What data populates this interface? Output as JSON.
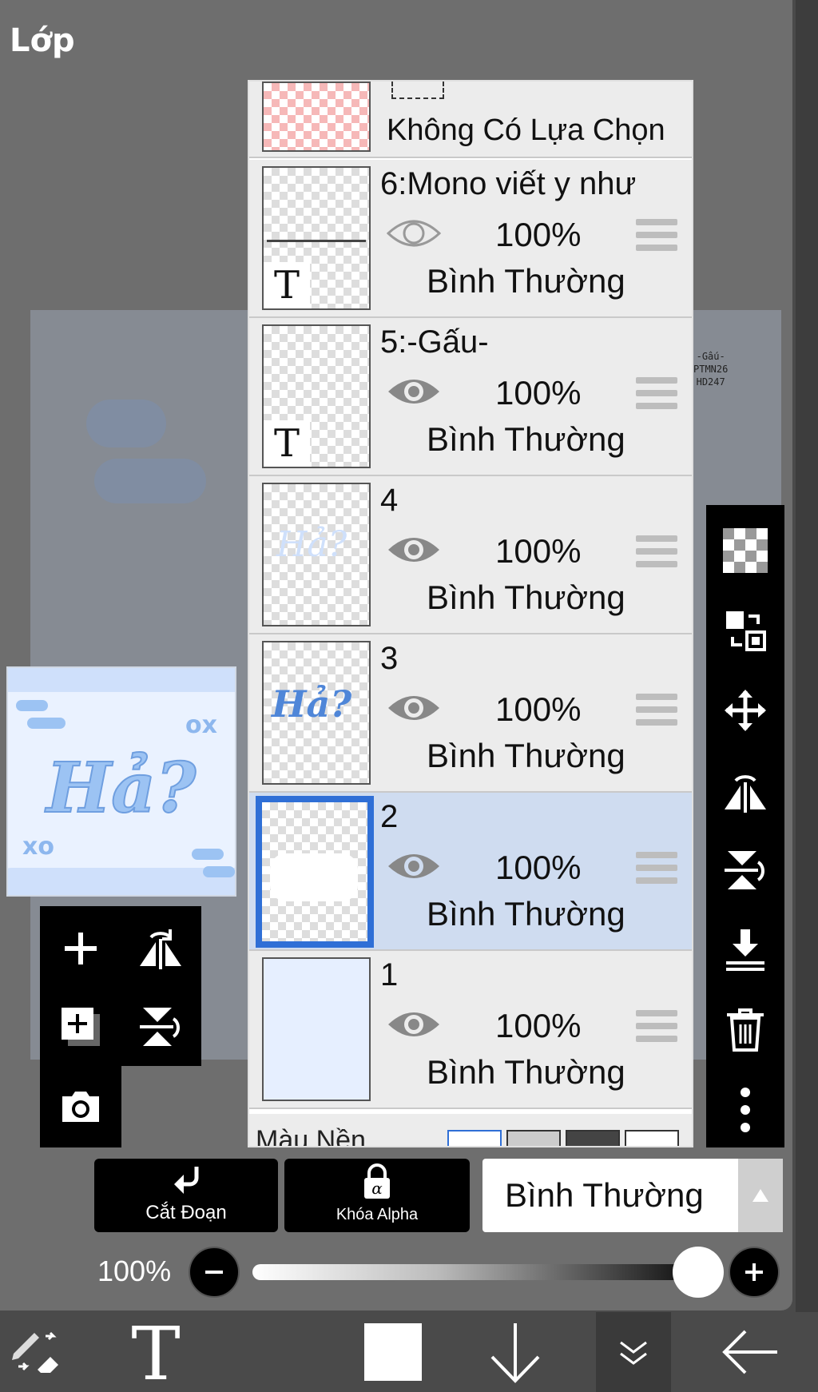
{
  "header": {
    "title": "Lớp"
  },
  "canvas": {
    "watermark_lines": [
      "-Gấu-",
      "PTMN26",
      "HD247"
    ]
  },
  "preview": {
    "script_text": "Hả?",
    "ox_top": "ox",
    "xo_bottom": "xo"
  },
  "selection_row": {
    "label": "Không Có Lựa Chọn"
  },
  "layers": [
    {
      "name": "6:Mono viết y như",
      "opacity": "100%",
      "blend": "Bình Thường",
      "type": "text",
      "badge": "T",
      "visible": true,
      "selected": false
    },
    {
      "name": "5:-Gấu-",
      "opacity": "100%",
      "blend": "Bình Thường",
      "type": "text",
      "badge": "T",
      "visible": true,
      "selected": false
    },
    {
      "name": "4",
      "opacity": "100%",
      "blend": "Bình Thường",
      "type": "image",
      "visible": true,
      "selected": false
    },
    {
      "name": "3",
      "opacity": "100%",
      "blend": "Bình Thường",
      "type": "image",
      "visible": true,
      "selected": false
    },
    {
      "name": "2",
      "opacity": "100%",
      "blend": "Bình Thường",
      "type": "image",
      "visible": true,
      "selected": true
    },
    {
      "name": "1",
      "opacity": "100%",
      "blend": "Bình Thường",
      "type": "image",
      "visible": true,
      "selected": false
    }
  ],
  "background_row": {
    "label": "Màu Nền"
  },
  "bottom_controls": {
    "clip_label": "Cắt Đoạn",
    "alpha_lock_label": "Khóa Alpha",
    "blend_mode": "Bình Thường",
    "opacity_label": "100%",
    "opacity_value": 1.0
  },
  "colors": {
    "selected_accent": "#2f6fd6",
    "panel_bg": "#6e6e6e",
    "selected_row": "#cfdcf0"
  },
  "icons": {
    "left_tools": [
      "plus-icon",
      "flip-horizontal-icon",
      "add-layer-icon",
      "flip-vertical-icon",
      "camera-icon"
    ],
    "right_tools": [
      "transparency-icon",
      "swap-icon",
      "move-icon",
      "flip-horizontal-icon",
      "flip-vertical-icon",
      "merge-down-icon",
      "trash-icon",
      "more-icon"
    ],
    "bottom_bar": [
      "brush-eraser-icon",
      "text-tool-icon",
      "color-swatch-icon",
      "arrow-down-icon",
      "chevron-double-down-icon",
      "back-arrow-icon"
    ]
  }
}
